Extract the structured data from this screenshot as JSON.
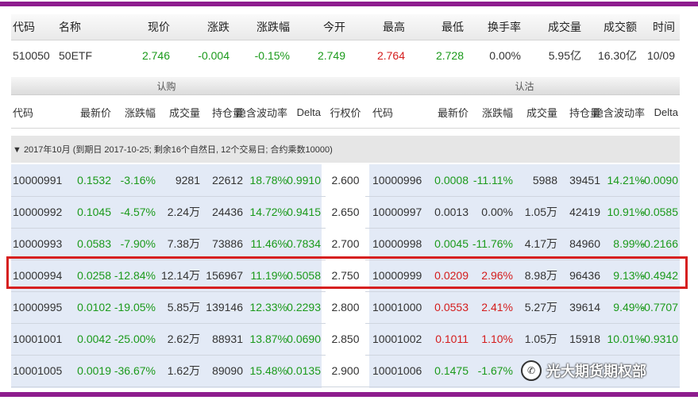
{
  "colors": {
    "accent_bar": "#8e1d8e",
    "up": "#d41c1c",
    "down": "#1b9a1b",
    "highlight_box": "#d62020",
    "row_tint": "#e3eaf6"
  },
  "quote": {
    "headers": [
      "代码",
      "名称",
      "现价",
      "涨跌",
      "涨跌幅",
      "今开",
      "最高",
      "最低",
      "换手率",
      "成交量",
      "成交额",
      "时间"
    ],
    "row": [
      "510050",
      "50ETF",
      "2.746",
      "-0.004",
      "-0.15%",
      "2.749",
      "2.764",
      "2.728",
      "0.00%",
      "5.95亿",
      "16.30亿",
      "10/09"
    ]
  },
  "options": {
    "calls_label": "认购",
    "puts_label": "认沽",
    "columns": [
      "代码",
      "最新价",
      "涨跌幅",
      "成交量",
      "持仓量",
      "隐含波动率",
      "Delta",
      "行权价",
      "代码",
      "最新价",
      "涨跌幅",
      "成交量",
      "持仓量",
      "隐含波动率",
      "Delta"
    ],
    "group_label": "▼ 2017年10月 (到期日 2017-10-25; 剩余16个自然日, 12个交易日; 合约乘数10000)",
    "rows": [
      [
        "10000991",
        "0.1532",
        "-3.16%",
        "9281",
        "22612",
        "18.78%",
        "0.9910",
        "2.600",
        "10000996",
        "0.0008",
        "-11.11%",
        "5988",
        "39451",
        "14.21%",
        "-0.0090"
      ],
      [
        "10000992",
        "0.1045",
        "-4.57%",
        "2.24万",
        "24436",
        "14.72%",
        "0.9415",
        "2.650",
        "10000997",
        "0.0013",
        "0.00%",
        "1.05万",
        "42419",
        "10.91%",
        "-0.0585"
      ],
      [
        "10000993",
        "0.0583",
        "-7.90%",
        "7.38万",
        "73886",
        "11.46%",
        "0.7834",
        "2.700",
        "10000998",
        "0.0045",
        "-11.76%",
        "4.17万",
        "84960",
        "8.99%",
        "-0.2166"
      ],
      [
        "10000994",
        "0.0258",
        "-12.84%",
        "12.14万",
        "156967",
        "11.19%",
        "0.5058",
        "2.750",
        "10000999",
        "0.0209",
        "2.96%",
        "8.98万",
        "96436",
        "9.13%",
        "-0.4942"
      ],
      [
        "10000995",
        "0.0102",
        "-19.05%",
        "5.85万",
        "139146",
        "12.33%",
        "0.2293",
        "2.800",
        "10001000",
        "0.0553",
        "2.41%",
        "5.27万",
        "39614",
        "9.49%",
        "-0.7707"
      ],
      [
        "10001001",
        "0.0042",
        "-25.00%",
        "2.62万",
        "88931",
        "13.87%",
        "0.0690",
        "2.850",
        "10001002",
        "0.1011",
        "1.10%",
        "1.05万",
        "15918",
        "10.01%",
        "-0.9310"
      ],
      [
        "10001005",
        "0.0019",
        "-36.67%",
        "1.62万",
        "89090",
        "15.48%",
        "0.0135",
        "2.900",
        "10001006",
        "0.1475",
        "-1.67%",
        "",
        "",
        "",
        ""
      ]
    ]
  },
  "watermark": {
    "text": "光大期货期权部",
    "icon": "wechat-icon"
  }
}
